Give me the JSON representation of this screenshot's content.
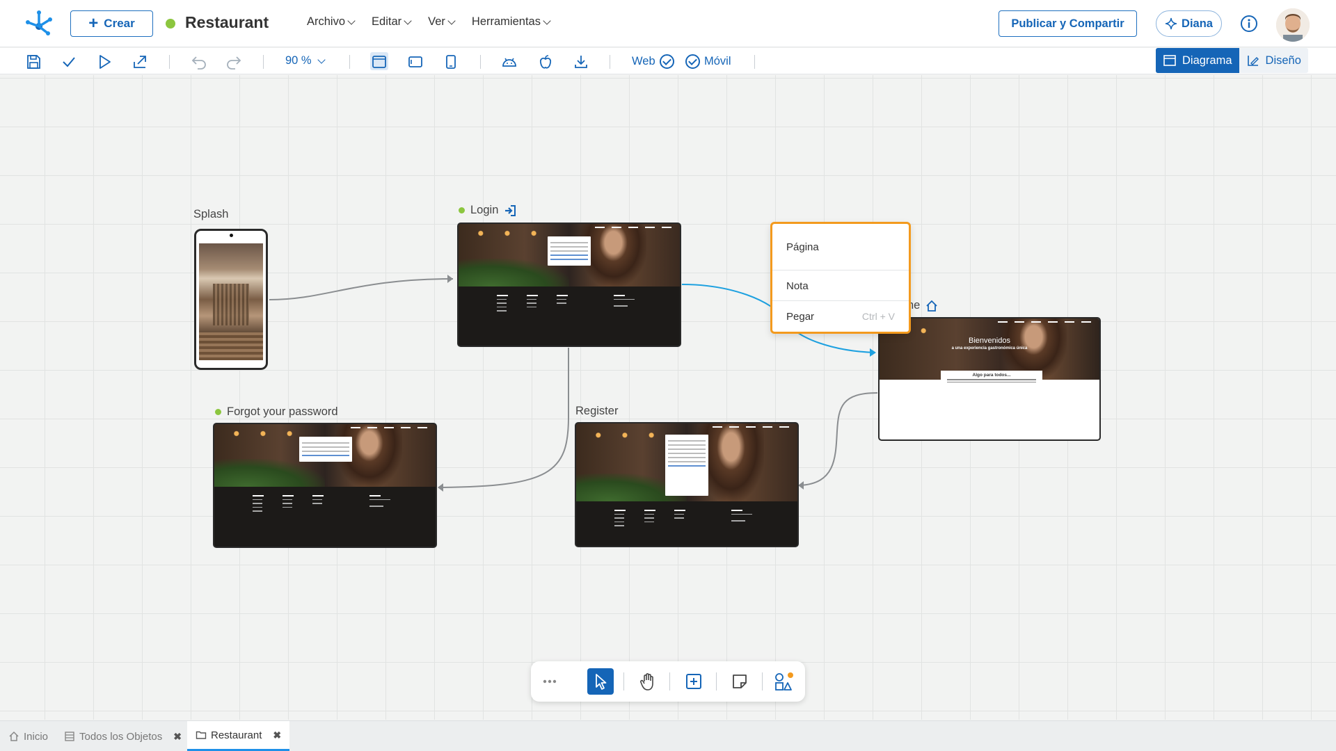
{
  "header": {
    "create_label": "Crear",
    "app_title": "Restaurant",
    "menus": [
      "Archivo",
      "Editar",
      "Ver",
      "Herramientas"
    ],
    "publish_label": "Publicar y Compartir",
    "assistant_label": "Diana"
  },
  "toolbar": {
    "zoom": "90 %",
    "platform_web": "Web",
    "platform_mobile": "Móvil",
    "view_diagram": "Diagrama",
    "view_design": "Diseño"
  },
  "nodes": {
    "splash": "Splash",
    "login": "Login",
    "forgot": "Forgot your password",
    "register": "Register",
    "home": "ne"
  },
  "home_preview": {
    "title": "Bienvenidos",
    "subtitle": "a una experiencia gastronómica única",
    "box_title": "Algo para todos..."
  },
  "context_menu": {
    "item_page": "Página",
    "item_note": "Nota",
    "item_paste": "Pegar",
    "paste_shortcut": "Ctrl + V"
  },
  "tabs": {
    "home": "Inicio",
    "all_objects": "Todos los Objetos",
    "restaurant": "Restaurant"
  },
  "colors": {
    "brand_blue": "#1565b7",
    "status_green": "#8cc63f",
    "menu_highlight": "#f39a1e",
    "connector_gray": "#8a8d90",
    "connector_blue": "#1ea1e0"
  }
}
